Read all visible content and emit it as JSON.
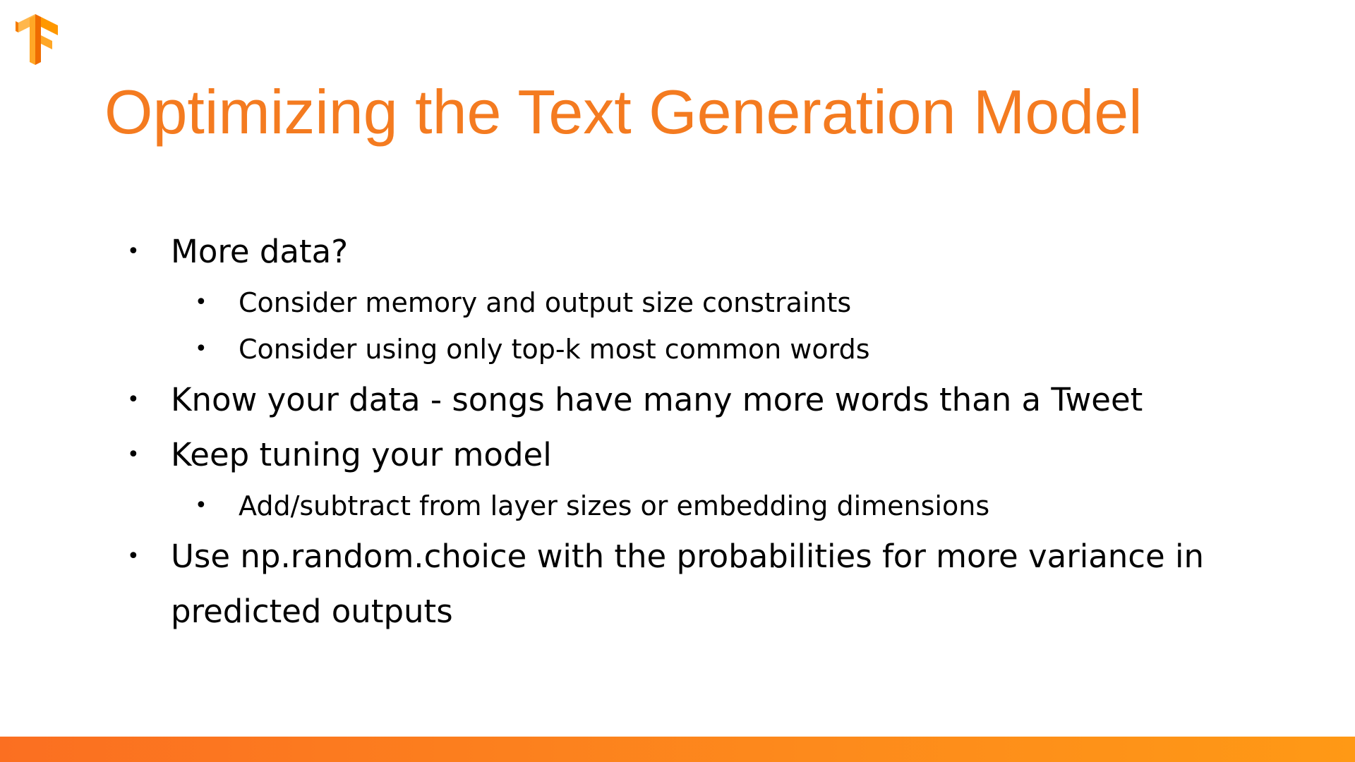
{
  "slide": {
    "title": "Optimizing the Text Generation Model",
    "bullets": [
      {
        "level": 1,
        "text": "More data?"
      },
      {
        "level": 2,
        "text": "Consider memory and output size constraints"
      },
      {
        "level": 2,
        "text": "Consider using only top-k most common words"
      },
      {
        "level": 1,
        "text": "Know your data - songs have many more words than a Tweet"
      },
      {
        "level": 1,
        "text": "Keep tuning your model"
      },
      {
        "level": 2,
        "text": "Add/subtract from layer sizes or embedding dimensions"
      },
      {
        "level": 1,
        "text": "Use np.random.choice with the probabilities for more variance in predicted outputs"
      }
    ],
    "bullet_glyph": "•"
  },
  "icons": {
    "logo": "tensorflow-logo-icon"
  },
  "colors": {
    "title": "#f47b20",
    "logo_light": "#ffa726",
    "logo_dark": "#f57c00",
    "bar_start": "#fb6f21",
    "bar_end": "#ff9915"
  }
}
